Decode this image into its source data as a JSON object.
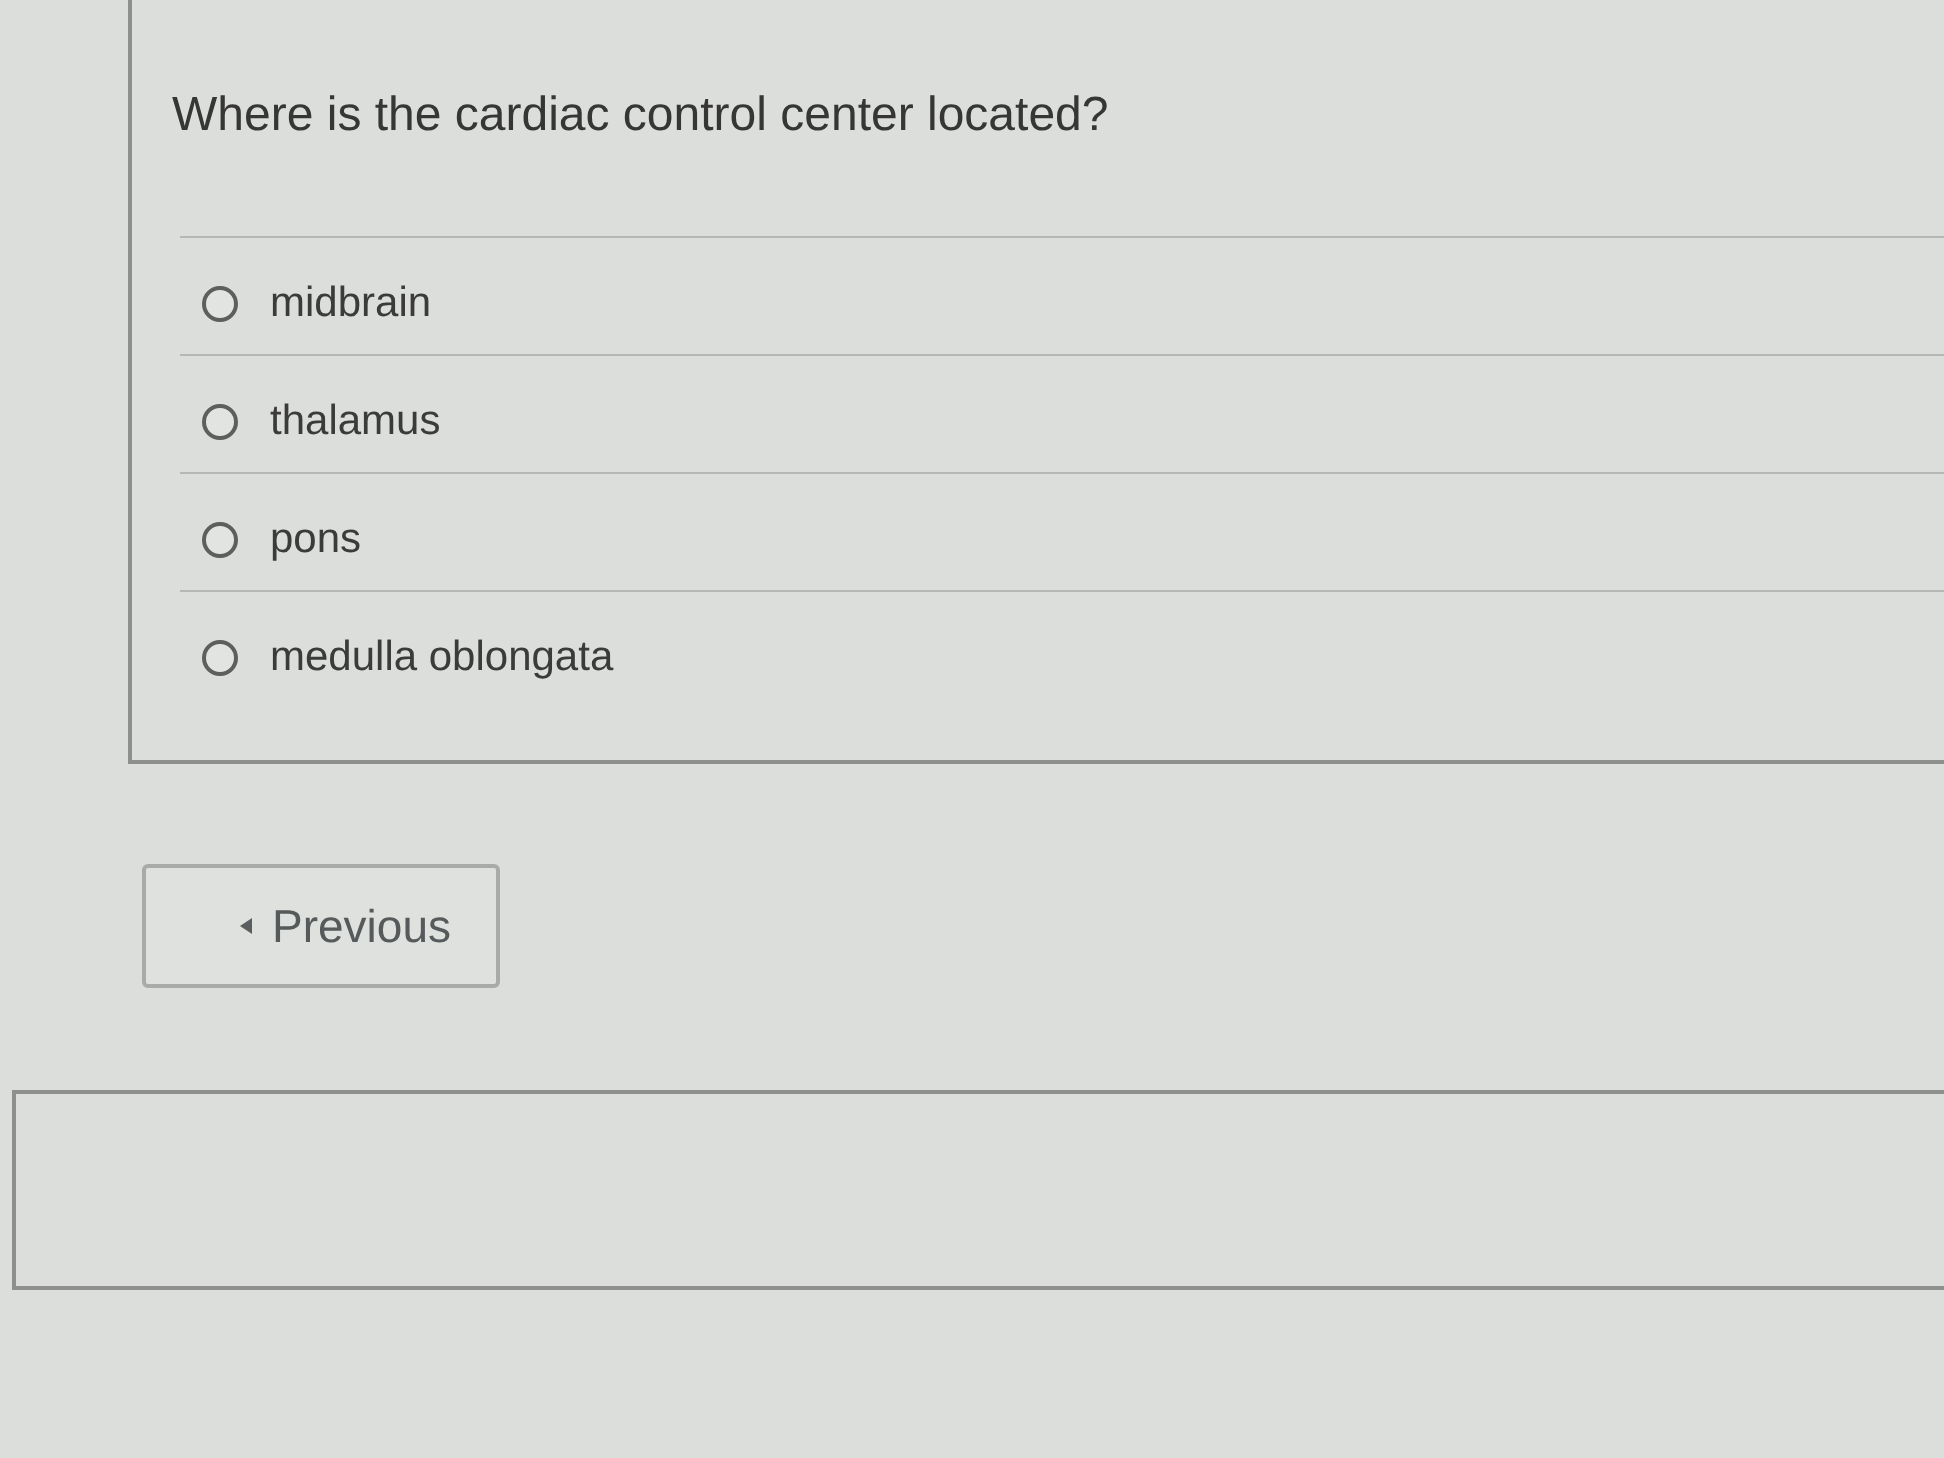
{
  "question": {
    "text": "Where is the cardiac control center located?",
    "options": [
      {
        "label": "midbrain",
        "selected": false
      },
      {
        "label": "thalamus",
        "selected": false
      },
      {
        "label": "pons",
        "selected": false
      },
      {
        "label": "medulla oblongata",
        "selected": false
      }
    ]
  },
  "navigation": {
    "previous_button": {
      "label": "Previous"
    }
  }
}
